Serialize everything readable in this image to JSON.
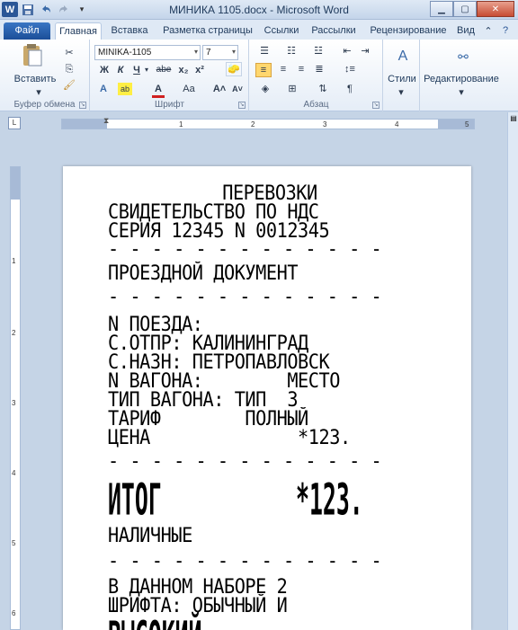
{
  "window": {
    "title": "МИНИКА 1105.docx - Microsoft Word",
    "app_icon": "W"
  },
  "tabs": [
    "Файл",
    "Главная",
    "Вставка",
    "Разметка страницы",
    "Ссылки",
    "Рассылки",
    "Рецензирование",
    "Вид"
  ],
  "ribbon": {
    "clipboard": {
      "label": "Буфер обмена",
      "paste": "Вставить"
    },
    "font": {
      "label": "Шрифт",
      "font_name": "MINIKA-1105",
      "font_size": "7",
      "bold": "Ж",
      "italic": "К",
      "underline": "Ч",
      "strike": "abe",
      "sub": "x₂",
      "sup": "x²",
      "case": "Aa",
      "grow": "A˄",
      "shrink": "A˅"
    },
    "paragraph": {
      "label": "Абзац",
      "pilcrow": "¶"
    },
    "styles": {
      "label": "Стили"
    },
    "editing": {
      "label": "Редактирование"
    }
  },
  "ruler": {
    "ticks": [
      "1",
      "2",
      "3",
      "4",
      "5"
    ],
    "vticks": [
      "1",
      "2",
      "3",
      "4",
      "5",
      "6"
    ]
  },
  "document": {
    "lines": [
      "ПЕРЕВОЗКИ",
      "СВИДЕТЕЛЬСТВО ПО НДС",
      "СЕРИЯ 12345 N 0012345",
      "- - - - - - - - - - - - -",
      "ПРОЕЗДНОЙ ДОКУМЕНТ",
      "- - - - - - - - - - - - -",
      "N ПОЕЗДА:",
      "С.ОТПР: КАЛИНИНГРАД",
      "С.НАЗН: ПЕТРОПАВЛОВСК",
      "N ВАГОНА:        МЕСТО",
      "ТИП ВАГОНА: ТИП  3",
      "ТАРИФ        ПОЛНЫЙ",
      "ЦЕНА              *123.",
      "- - - - - - - - - - - - -",
      "ИТОГ          *123.",
      "НАЛИЧНЫЕ",
      "- - - - - - - - - - - - -",
      "В ДАННОМ НАБОРЕ 2",
      "ШРИФТА: ОБЫЧНЫЙ И",
      "ВЫСОКИЙ"
    ]
  }
}
